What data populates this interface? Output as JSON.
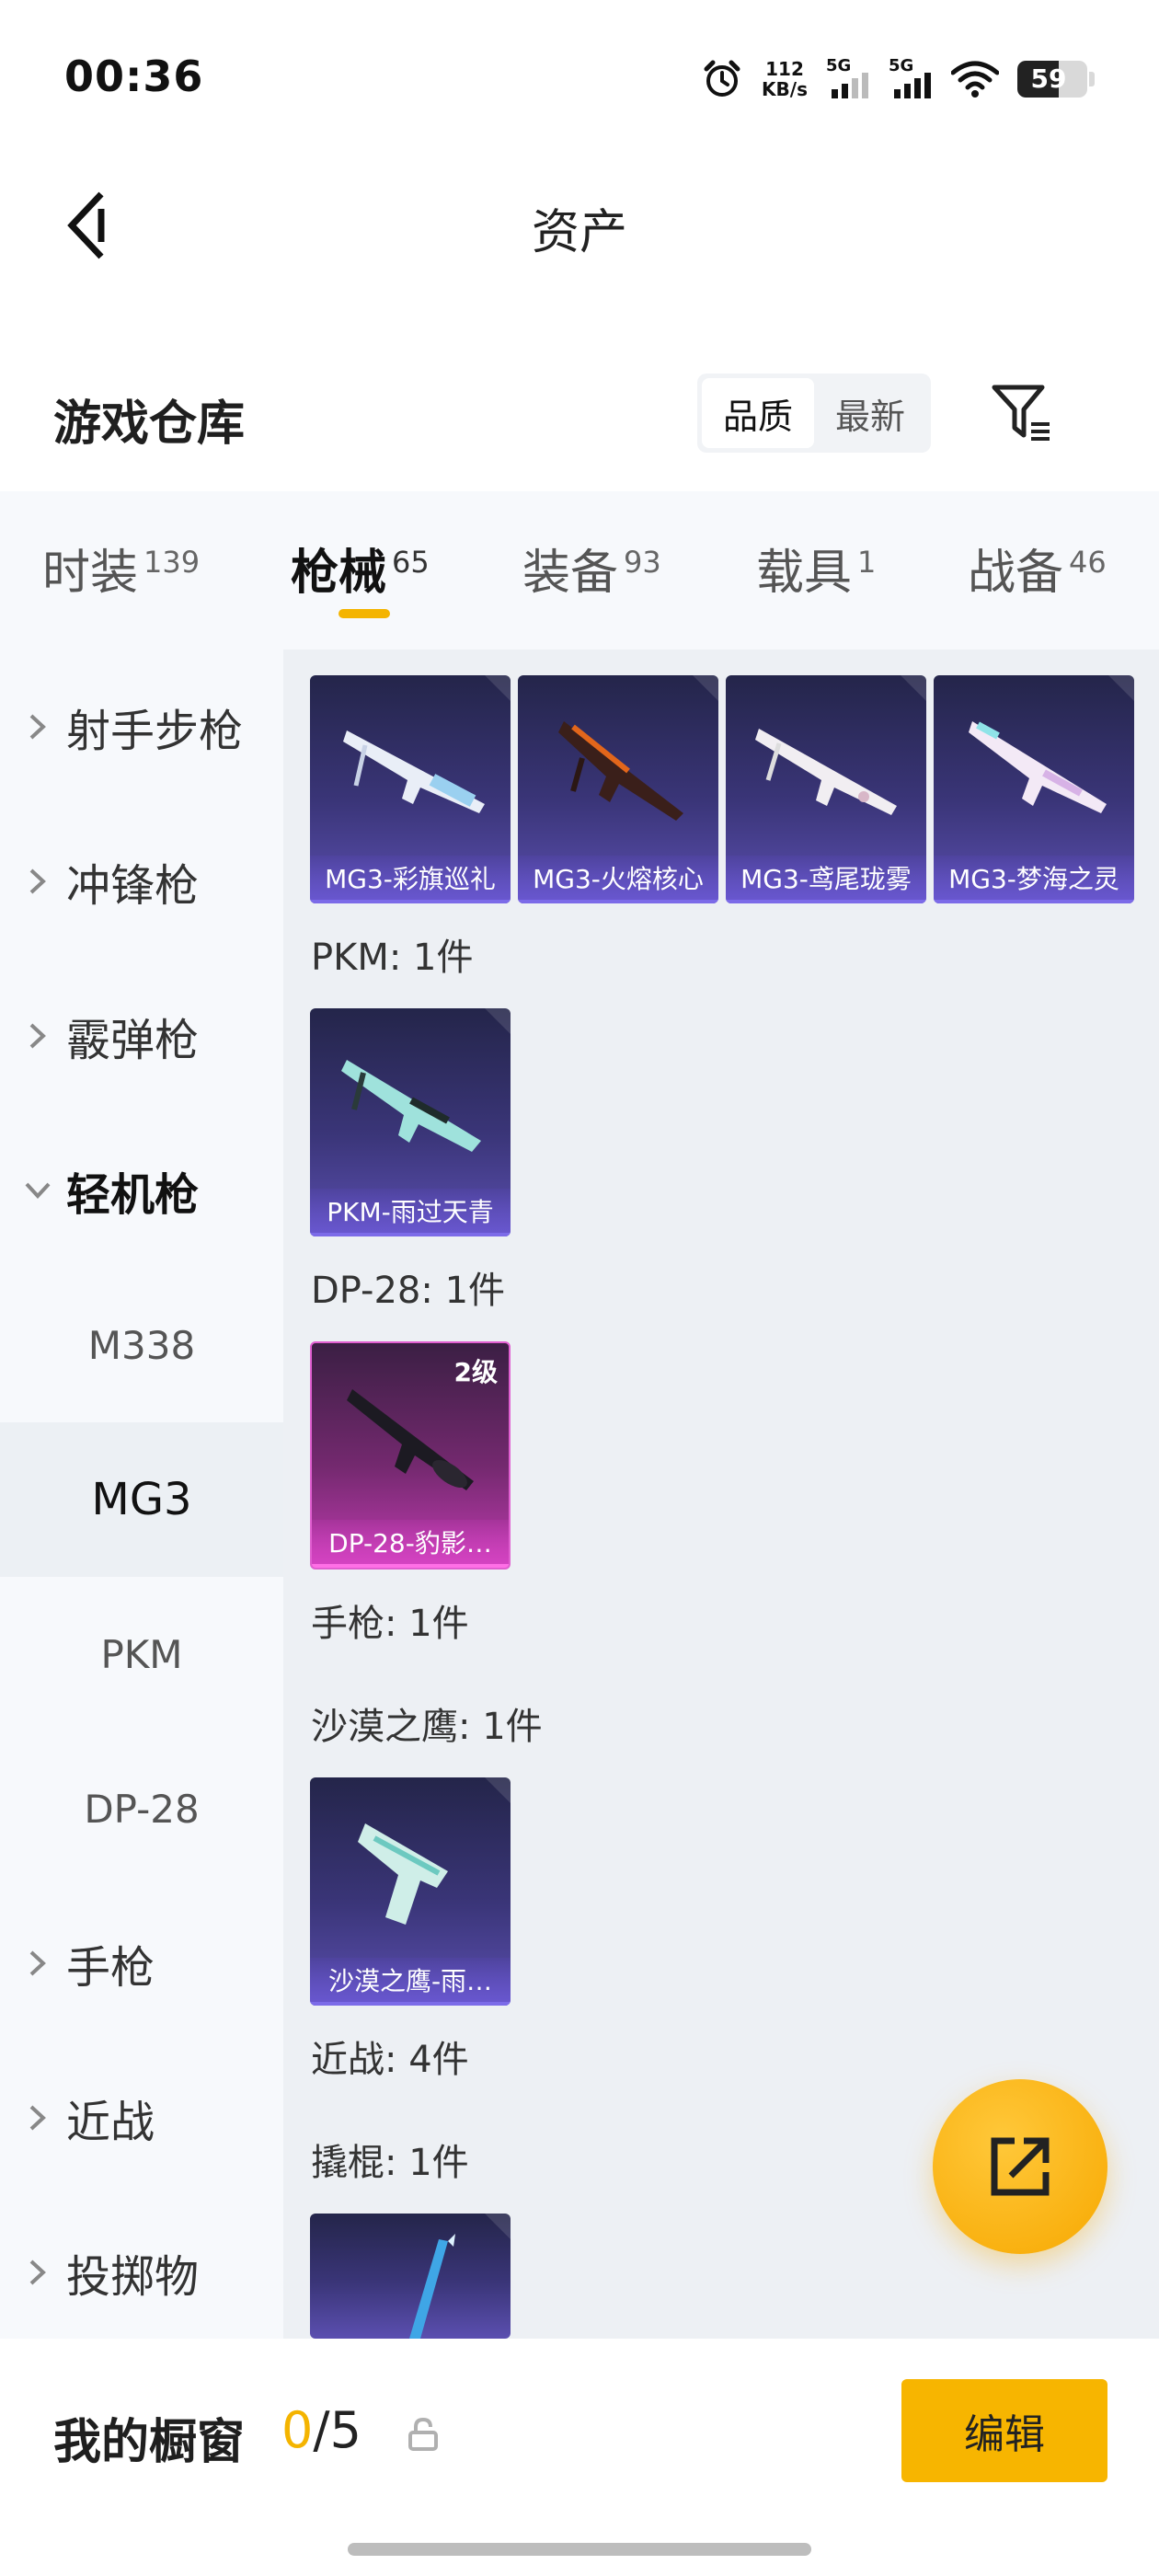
{
  "status_bar": {
    "time": "00:36",
    "net_speed": "112",
    "net_unit": "KB/s",
    "sim1": "5G",
    "sim2": "5G",
    "battery": "59",
    "battery_level": 0.59
  },
  "header": {
    "title": "资产",
    "back_icon": "chevron-left-icon"
  },
  "warehouse": {
    "title": "游戏仓库",
    "sort_options": [
      "品质",
      "最新"
    ],
    "active_sort": "品质",
    "filter_icon": "filter-icon"
  },
  "category_tabs": [
    {
      "label": "时装",
      "count": "139"
    },
    {
      "label": "枪械",
      "count": "65"
    },
    {
      "label": "装备",
      "count": "93"
    },
    {
      "label": "载具",
      "count": "1"
    },
    {
      "label": "战备",
      "count": "46"
    }
  ],
  "active_category": "枪械",
  "sidebar": [
    {
      "label": "射手步枪",
      "type": "group",
      "expanded": false
    },
    {
      "label": "冲锋枪",
      "type": "group",
      "expanded": false
    },
    {
      "label": "霰弹枪",
      "type": "group",
      "expanded": false
    },
    {
      "label": "轻机枪",
      "type": "group",
      "expanded": true
    },
    {
      "label": "M338",
      "type": "sub"
    },
    {
      "label": "MG3",
      "type": "sub",
      "active": true
    },
    {
      "label": "PKM",
      "type": "sub"
    },
    {
      "label": "DP-28",
      "type": "sub"
    },
    {
      "label": "手枪",
      "type": "group",
      "expanded": false
    },
    {
      "label": "近战",
      "type": "group",
      "expanded": false
    },
    {
      "label": "投掷物",
      "type": "group",
      "expanded": false
    }
  ],
  "content": {
    "mg3_items": [
      "MG3-彩旗巡礼",
      "MG3-火熔核心",
      "MG3-鸢尾珑雾",
      "MG3-梦海之灵"
    ],
    "pkm_label": "PKM: 1件",
    "pkm_items": [
      "PKM-雨过天青"
    ],
    "dp28_label": "DP-28: 1件",
    "dp28_items": [
      {
        "name": "DP-28-豹影…",
        "level": "2级"
      }
    ],
    "pistol_label": "手枪: 1件",
    "deagle_label": "沙漠之鹰: 1件",
    "deagle_items": [
      "沙漠之鹰-雨…"
    ],
    "melee_label": "近战: 4件",
    "crowbar_label": "撬棍: 1件"
  },
  "fab": {
    "icon": "share-icon"
  },
  "bottom_bar": {
    "label": "我的橱窗",
    "current": "0",
    "separator": "/",
    "total": "5",
    "lock_icon": "lock-icon",
    "edit_label": "编辑"
  },
  "colors": {
    "accent": "#f4b400",
    "card_purple": "#3a3578",
    "card_magenta": "#c03bb0",
    "content_bg": "#edf0f4",
    "sidebar_bg": "#f7f9fc"
  }
}
